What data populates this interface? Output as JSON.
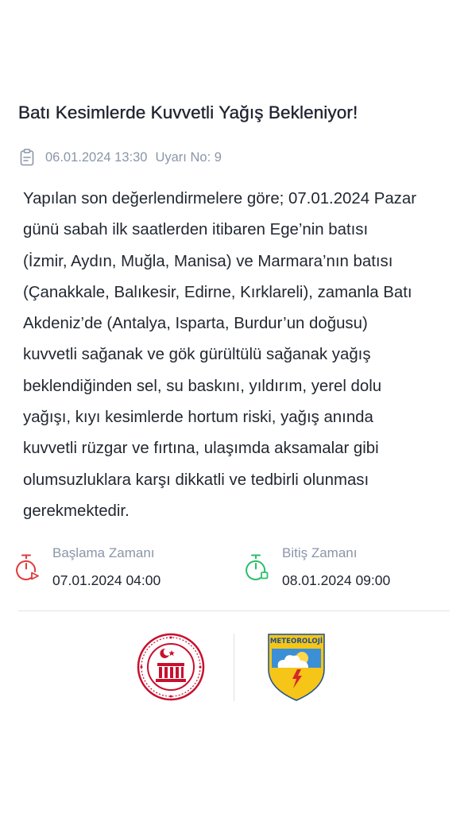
{
  "warning": {
    "title": "Batı Kesimlerde Kuvvetli Yağış Bekleniyor!",
    "date": "06.01.2024 13:30",
    "number": "Uyarı No: 9",
    "body_lines": [
      "Yapılan son değerlendirmelere göre; 07.01.2024 Pazar",
      "günü sabah ilk saatlerden itibaren Ege’nin batısı",
      "(İzmir, Aydın, Muğla, Manisa) ve Marmara’nın batısı",
      "(Çanakkale, Balıkesir, Edirne, Kırklareli), zamanla Batı",
      "Akdeniz’de (Antalya, Isparta, Burdur’un doğusu)",
      "kuvvetli sağanak ve gök gürültülü sağanak yağış",
      "beklendiğinden sel, su baskını, yıldırım, yerel dolu",
      "yağışı, kıyı kesimlerde hortum riski, yağış anında",
      "kuvvetli rüzgar ve fırtına, ulaşımda aksamalar gibi",
      "olumsuzluklara karşı dikkatli ve tedbirli olunması",
      "gerekmektedir."
    ]
  },
  "start": {
    "label": "Başlama Zamanı",
    "value": "07.01.2024 04:00",
    "icon": "stopwatch-icon",
    "color": "#e03a3a"
  },
  "end": {
    "label": "Bitiş Zamanı",
    "value": "08.01.2024 09:00",
    "icon": "stopwatch-icon",
    "color": "#2bbf6a"
  },
  "logos": {
    "left": {
      "name": "ministry-seal",
      "color": "#c8102e"
    },
    "right": {
      "name": "meteoroloji-logo",
      "text": "METEOROLOJİ",
      "color": "#f5c518"
    }
  }
}
